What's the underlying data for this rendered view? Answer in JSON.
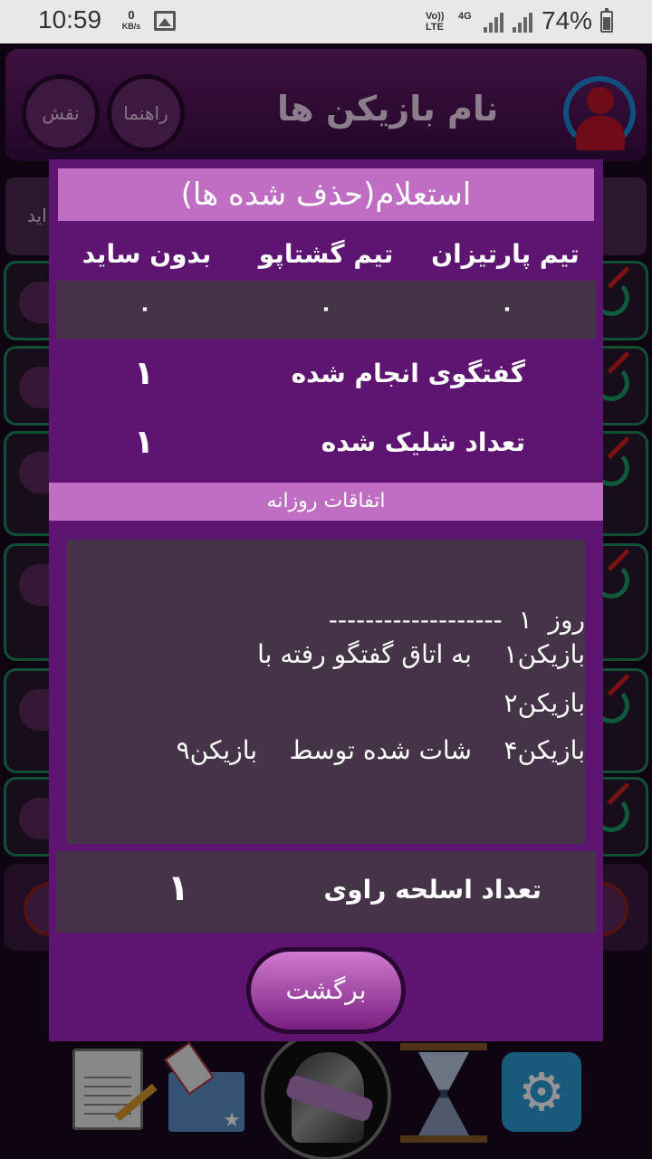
{
  "status_bar": {
    "time": "10:59",
    "speed_value": "0",
    "speed_unit": "KB/s",
    "volte": "Vo))",
    "lte": "LTE",
    "network": "4G",
    "battery": "74%"
  },
  "background": {
    "header_title": "نام بازیکن ها",
    "help_button": "راهنما",
    "role_button": "نقش",
    "strip_text": "اید"
  },
  "dialog": {
    "title": "استعلام(حذف شده ها)",
    "teams": [
      "تیم پارتیزان",
      "تیم گشتاپو",
      "بدون ساید"
    ],
    "counts": [
      "۰",
      "۰",
      "۰"
    ],
    "stats": [
      {
        "label": "گفتگوی انجام شده",
        "value": "۱"
      },
      {
        "label": "تعداد شلیک شده",
        "value": "۱"
      }
    ],
    "events_title": "اتفاقات روزانه",
    "log_lines": [
      "روز  ۱  -------------------",
      "بازیکن۱    به اتاق گفتگو رفته با",
      "بازیکن۲",
      "بازیکن۴    شات شده توسط    بازیکن۹"
    ],
    "weapons": {
      "label": "تعداد اسلحه راوی",
      "value": "۱"
    },
    "back_button": "برگشت"
  },
  "toolbar": {
    "icons": [
      "notes-icon",
      "vote-box-icon",
      "mafia-hat-icon",
      "hourglass-icon",
      "settings-icon"
    ]
  }
}
